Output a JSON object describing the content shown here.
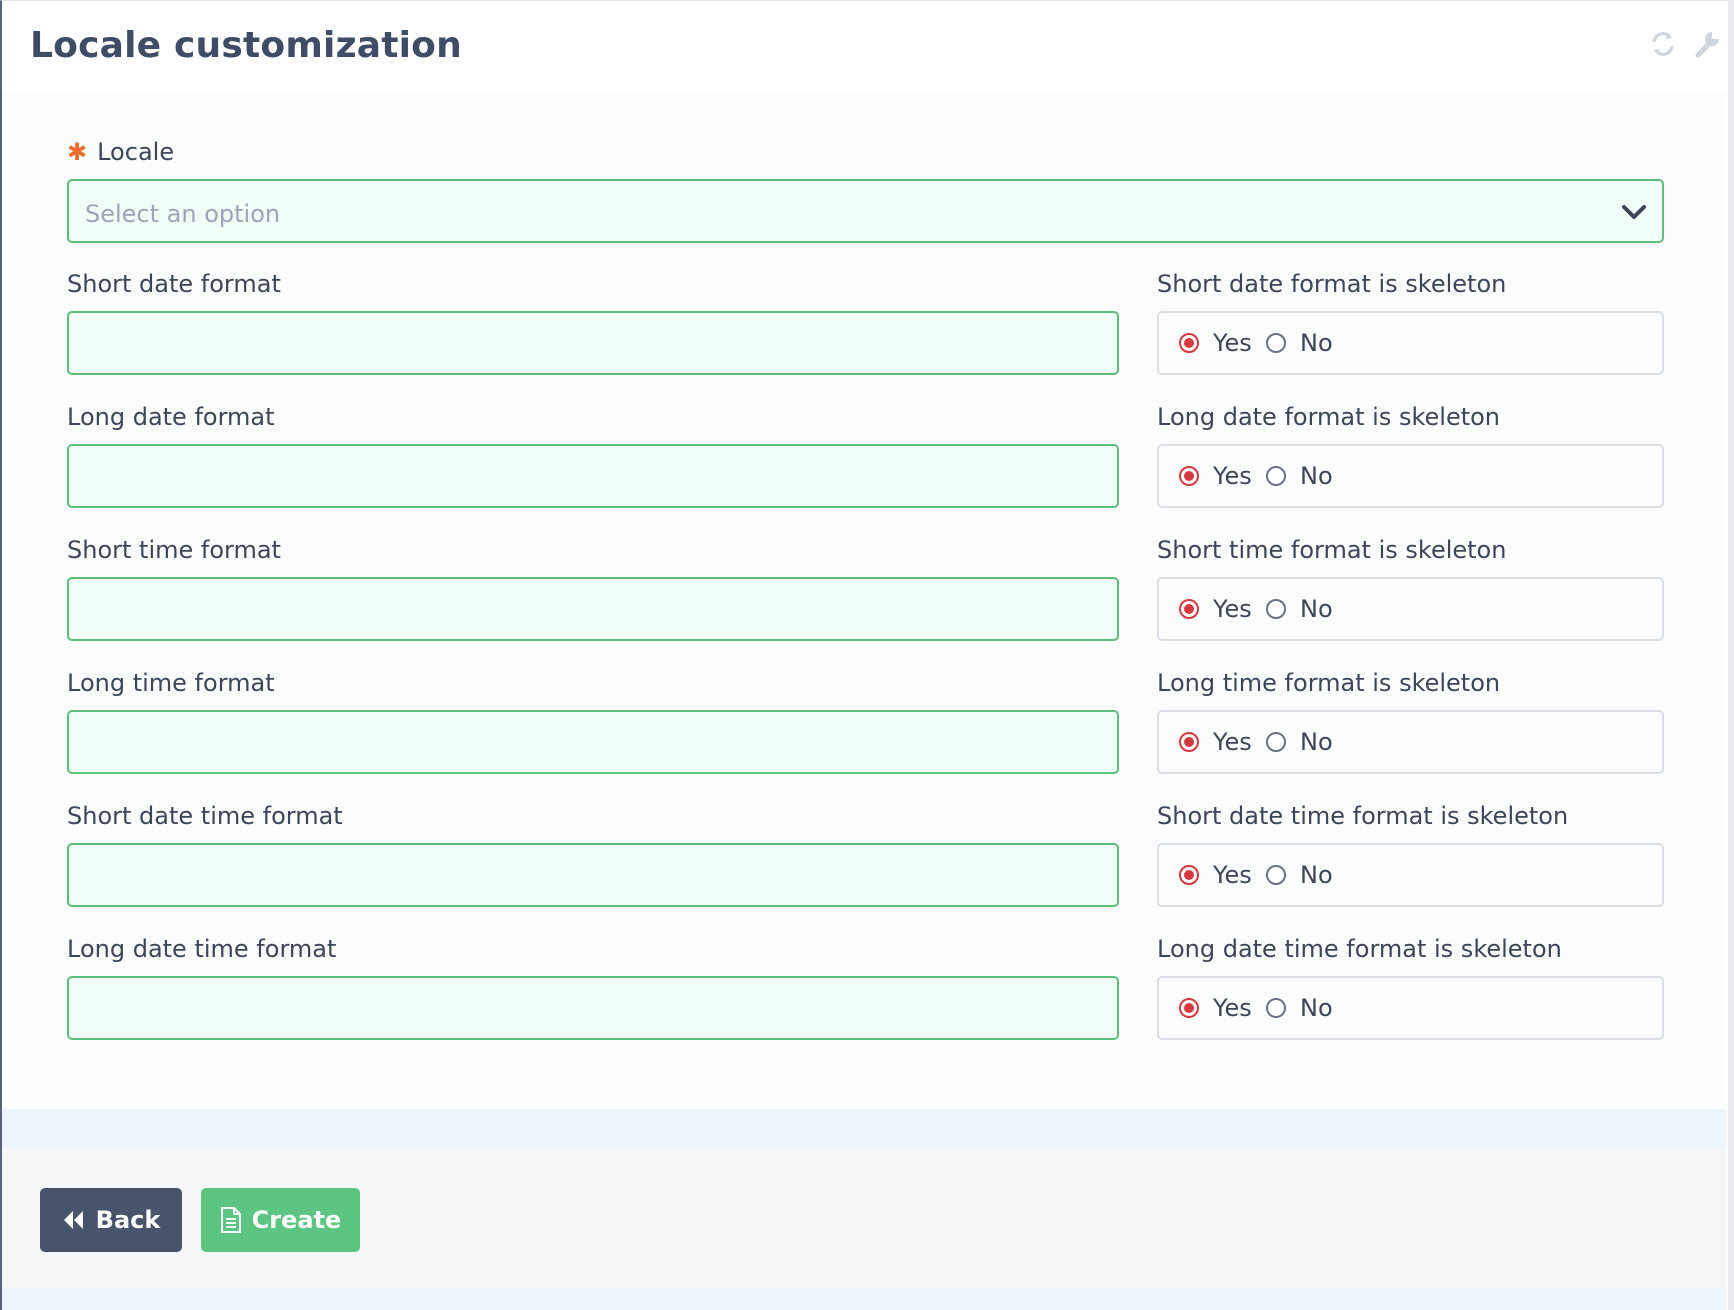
{
  "header": {
    "title": "Locale customization",
    "icons": [
      "refresh-icon",
      "wrench-icon"
    ],
    "icon_color": "#cfd5dd"
  },
  "locale": {
    "label": "Locale",
    "required_mark": "✱",
    "placeholder": "Select an option"
  },
  "rows": [
    {
      "format_label": "Short date format",
      "skeleton_label": "Short date format is skeleton",
      "yes": "Yes",
      "no": "No",
      "selected": "Yes",
      "value": ""
    },
    {
      "format_label": "Long date format",
      "skeleton_label": "Long date format is skeleton",
      "yes": "Yes",
      "no": "No",
      "selected": "Yes",
      "value": ""
    },
    {
      "format_label": "Short time format",
      "skeleton_label": "Short time format is skeleton",
      "yes": "Yes",
      "no": "No",
      "selected": "Yes",
      "value": ""
    },
    {
      "format_label": "Long time format",
      "skeleton_label": "Long time format is skeleton",
      "yes": "Yes",
      "no": "No",
      "selected": "Yes",
      "value": ""
    },
    {
      "format_label": "Short date time format",
      "skeleton_label": "Short date time format is skeleton",
      "yes": "Yes",
      "no": "No",
      "selected": "Yes",
      "value": ""
    },
    {
      "format_label": "Long date time format",
      "skeleton_label": "Long date time format is skeleton",
      "yes": "Yes",
      "no": "No",
      "selected": "Yes",
      "value": ""
    }
  ],
  "buttons": {
    "back": "Back",
    "create": "Create"
  },
  "colors": {
    "title": "#3e4c66",
    "input_bg": "#f1fdf7",
    "input_border": "#5dc07a",
    "radio_selected": "#d5393f",
    "required": "#ec6b2d",
    "back_button": "#48546c",
    "create_button": "#5cc581"
  }
}
